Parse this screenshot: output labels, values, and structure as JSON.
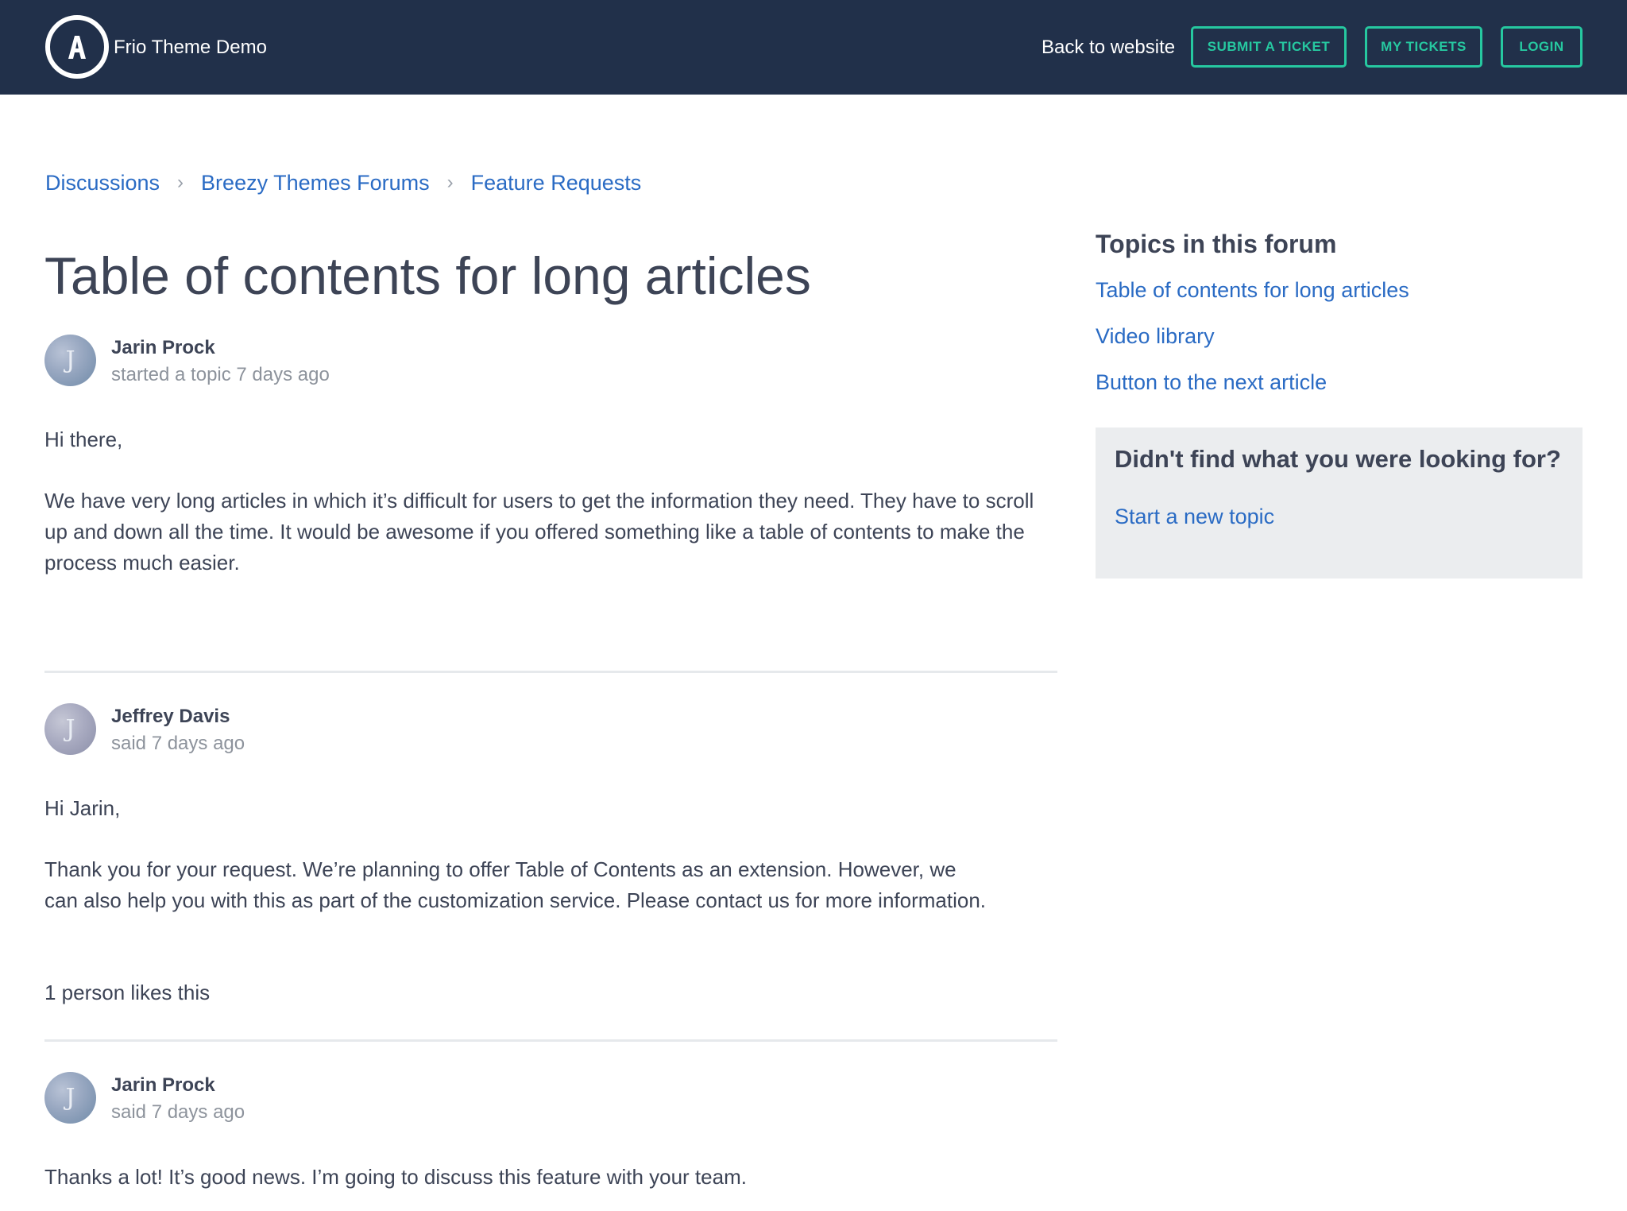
{
  "header": {
    "brand_name": "Frio Theme Demo",
    "logo_icon": "letter-a-circle-logo",
    "back_link": "Back to website",
    "buttons": {
      "submit_ticket": "SUBMIT A TICKET",
      "my_tickets": "MY TICKETS",
      "login": "LOGIN"
    }
  },
  "breadcrumb": {
    "items": [
      "Discussions",
      "Breezy Themes Forums",
      "Feature Requests"
    ],
    "separator": "›"
  },
  "page_title": "Table of contents for long articles",
  "posts": [
    {
      "author": "Jarin Prock",
      "avatar_letter": "J",
      "meta": "started a topic 7 days ago",
      "paragraphs": [
        "Hi there,",
        "We have very long articles in which it’s difficult for users to get the information they need. They have to scroll up and down all the time. It would be awesome if you offered something like a table of contents to make the process much easier."
      ]
    },
    {
      "author": "Jeffrey Davis",
      "avatar_letter": "J",
      "meta": "said 7 days ago",
      "paragraphs": [
        "Hi Jarin,",
        "Thank you for your request. We’re planning to offer Table of Contents as an extension. However, we can also help you with this as part of the customization service. Please contact us for more information."
      ],
      "likes": "1 person likes this"
    },
    {
      "author": "Jarin Prock",
      "avatar_letter": "J",
      "meta": "said 7 days ago",
      "paragraphs": [
        "Thanks a lot! It’s good news. I’m going to discuss this feature with your team."
      ]
    }
  ],
  "sidebar": {
    "title": "Topics in this forum",
    "topics": [
      "Table of contents for long articles",
      "Video library",
      "Button to the next article"
    ],
    "help_box": {
      "title": "Didn't find what you were looking for?",
      "link": "Start a new topic"
    }
  },
  "colors": {
    "header_bg": "#21304a",
    "accent": "#26c8a0",
    "link": "#2a6bc4",
    "text": "#3d4456",
    "muted": "#8d939c"
  }
}
